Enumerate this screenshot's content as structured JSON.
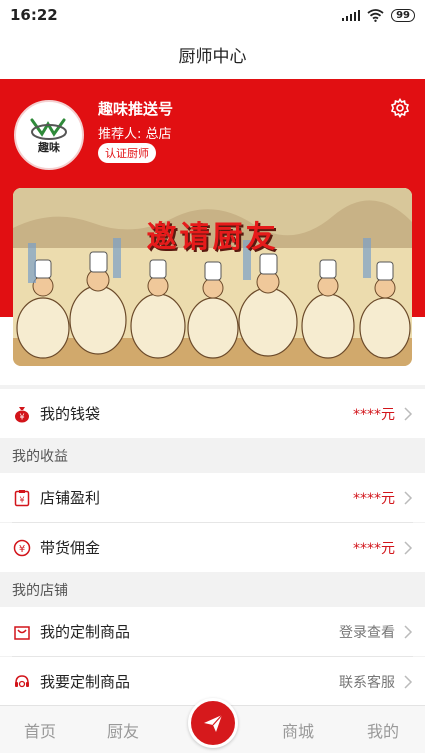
{
  "status_bar": {
    "time": "16:22",
    "battery": "99"
  },
  "nav": {
    "title": "厨师中心"
  },
  "profile": {
    "name": "趣味推送号",
    "referrer": "推荐人: 总店",
    "badge": "认证厨师",
    "avatar_text": "趣味"
  },
  "banner": {
    "title": "邀请厨友"
  },
  "wallet": {
    "label": "我的钱袋",
    "value": "****元"
  },
  "earnings": {
    "section_title": "我的收益",
    "items": [
      {
        "label": "店铺盈利",
        "value": "****元"
      },
      {
        "label": "带货佣金",
        "value": "****元"
      }
    ]
  },
  "shop": {
    "section_title": "我的店铺",
    "items": [
      {
        "label": "我的定制商品",
        "value": "登录查看"
      },
      {
        "label": "我要定制商品",
        "value": "联系客服"
      }
    ]
  },
  "tabbar": {
    "home": "首页",
    "friends": "厨友",
    "mall": "商城",
    "mine": "我的"
  },
  "colors": {
    "brand_red": "#e10f12",
    "value_red": "#d2141a",
    "tab_gray": "#999999"
  }
}
